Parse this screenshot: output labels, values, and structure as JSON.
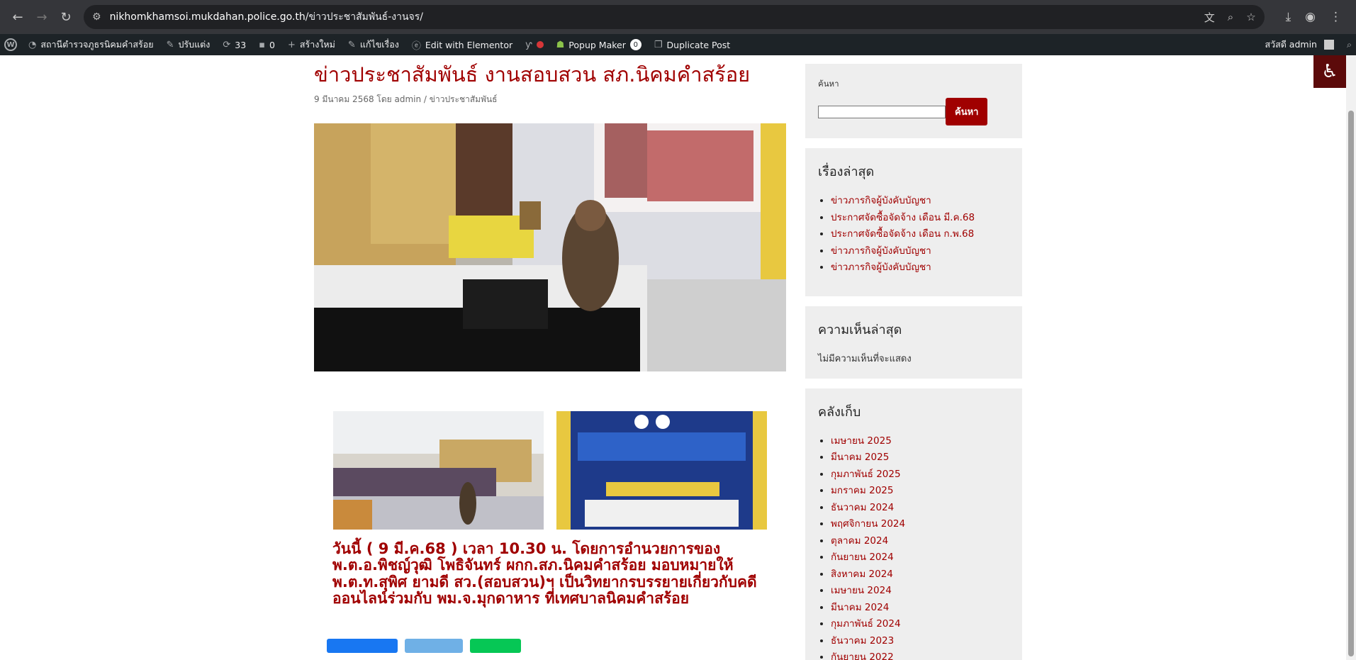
{
  "browser": {
    "url_host": "nikhomkhamsoi.mukdahan.police.go.th",
    "url_path": "/ข่าวประชาสัมพันธ์-งานจร/"
  },
  "adminbar": {
    "site_name": "สถานีตำรวจภูธรนิคมคำสร้อย",
    "customize": "ปรับแต่ง",
    "updates_count": "33",
    "comments_count": "0",
    "new": "สร้างใหม่",
    "edit": "แก้ไขเรื่อง",
    "elementor": "Edit with Elementor",
    "popup_maker": "Popup Maker",
    "popup_count": "0",
    "duplicate": "Duplicate Post",
    "greeting": "สวัสดี admin"
  },
  "post": {
    "title": "ข่าวประชาสัมพันธ์ งานสอบสวน สภ.นิคมคำสร้อย",
    "meta": "9 มีนาคม 2568 โดย admin / ข่าวประชาสัมพันธ์",
    "body": "วันนี้ ( 9 มี.ค.68 ) เวลา 10.30 น. โดยการอำนวยการของ พ.ต.อ.พิชญ์วุฒิ โพธิจันทร์ ผกก.สภ.นิคมคำสร้อย มอบหมายให้ พ.ต.ท.สุพิศ ยามดี สว.(สอบสวน)ฯ เป็นวิทยากรบรรยายเกี่ยวกับคดีออนไลน์ร่วมกับ พม.จ.มุกดาหาร ที่เทศบาลนิคมคำสร้อย"
  },
  "sidebar": {
    "search_label": "ค้นหา",
    "search_button": "ค้นหา",
    "recent_title": "เรื่องล่าสุด",
    "recent": [
      "ข่าวภารกิจผู้บังคับบัญชา",
      "ประกาศจัดซื้อจัดจ้าง เดือน มี.ค.68",
      "ประกาศจัดซื้อจัดจ้าง เดือน ก.พ.68",
      "ข่าวภารกิจผู้บังคับบัญชา",
      "ข่าวภารกิจผู้บังคับบัญชา"
    ],
    "comments_title": "ความเห็นล่าสุด",
    "no_comments": "ไม่มีความเห็นที่จะแสดง",
    "archive_title": "คลังเก็บ",
    "archives": [
      "เมษายน 2025",
      "มีนาคม 2025",
      "กุมภาพันธ์ 2025",
      "มกราคม 2025",
      "ธันวาคม 2024",
      "พฤศจิกายน 2024",
      "ตุลาคม 2024",
      "กันยายน 2024",
      "สิงหาคม 2024",
      "เมษายน 2024",
      "มีนาคม 2024",
      "กุมภาพันธ์ 2024",
      "ธันวาคม 2023",
      "กันยายน 2022"
    ]
  },
  "colors": {
    "accent": "#a00000",
    "adminbar": "#1d2327",
    "widget_bg": "#eeeeee"
  }
}
